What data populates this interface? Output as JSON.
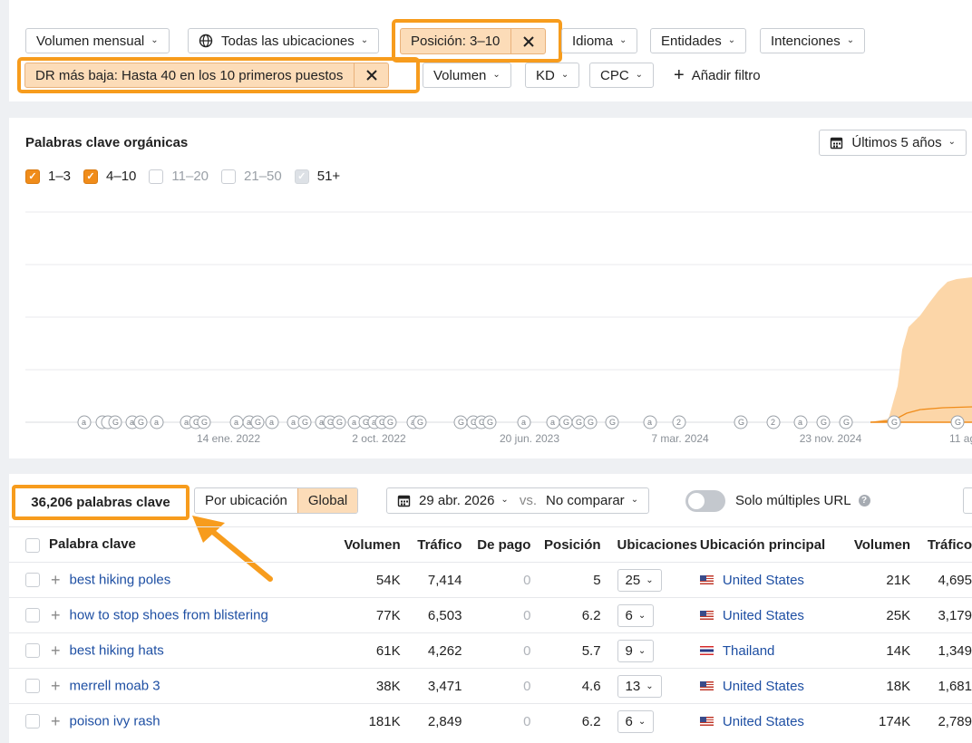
{
  "filters": {
    "row1": [
      {
        "label": "Volumen mensual",
        "type": "dropdown"
      },
      {
        "label": "Todas las ubicaciones",
        "type": "dropdown",
        "icon": "globe-icon"
      },
      {
        "label": "Posición: 3–10",
        "type": "active"
      },
      {
        "label": "Idioma",
        "type": "dropdown"
      },
      {
        "label": "Entidades",
        "type": "dropdown"
      },
      {
        "label": "Intenciones",
        "type": "dropdown"
      }
    ],
    "row2": [
      {
        "label": "DR más baja: Hasta 40 en los 10 primeros puestos",
        "type": "active"
      },
      {
        "label": "Volumen",
        "type": "dropdown"
      },
      {
        "label": "KD",
        "type": "dropdown"
      },
      {
        "label": "CPC",
        "type": "dropdown"
      }
    ],
    "add_filter": "Añadir filtro"
  },
  "chart": {
    "title": "Palabras clave orgánicas",
    "period": "Últimos 5 años",
    "legend": [
      {
        "label": "1–3",
        "checked": true
      },
      {
        "label": "4–10",
        "checked": true
      },
      {
        "label": "11–20",
        "checked": false
      },
      {
        "label": "21–50",
        "checked": false
      },
      {
        "label": "51+",
        "checked": false
      }
    ],
    "x_ticks": [
      "14 ene. 2022",
      "2 oct. 2022",
      "20 jun. 2023",
      "7 mar. 2024",
      "23 nov. 2024",
      "11 ag"
    ],
    "colors": {
      "area": "#fcd6a8",
      "line": "#f08c1a"
    }
  },
  "table": {
    "count": "36,206 palabras clave",
    "view_toggle": [
      "Por ubicación",
      "Global"
    ],
    "date": "29 abr. 2026",
    "vs": "vs.",
    "compare": "No comparar",
    "multi_url": "Solo múltiples URL",
    "headers": [
      "Palabra clave",
      "Volumen",
      "Tráfico",
      "De pago",
      "Posición",
      "Ubicaciones",
      "Ubicación principal",
      "Volumen",
      "Tráfico"
    ],
    "rows": [
      {
        "keyword": "best hiking poles",
        "volume": "54K",
        "traffic": "7,414",
        "paid": "0",
        "position": "5",
        "locations": "25",
        "flag": "us",
        "country": "United States",
        "loc_volume": "21K",
        "loc_traffic": "4,695"
      },
      {
        "keyword": "how to stop shoes from blistering",
        "volume": "77K",
        "traffic": "6,503",
        "paid": "0",
        "position": "6.2",
        "locations": "6",
        "flag": "us",
        "country": "United States",
        "loc_volume": "25K",
        "loc_traffic": "3,179"
      },
      {
        "keyword": "best hiking hats",
        "volume": "61K",
        "traffic": "4,262",
        "paid": "0",
        "position": "5.7",
        "locations": "9",
        "flag": "th",
        "country": "Thailand",
        "loc_volume": "14K",
        "loc_traffic": "1,349"
      },
      {
        "keyword": "merrell moab 3",
        "volume": "38K",
        "traffic": "3,471",
        "paid": "0",
        "position": "4.6",
        "locations": "13",
        "flag": "us",
        "country": "United States",
        "loc_volume": "18K",
        "loc_traffic": "1,681"
      },
      {
        "keyword": "poison ivy rash",
        "volume": "181K",
        "traffic": "2,849",
        "paid": "0",
        "position": "6.2",
        "locations": "6",
        "flag": "us",
        "country": "United States",
        "loc_volume": "174K",
        "loc_traffic": "2,789"
      }
    ]
  }
}
